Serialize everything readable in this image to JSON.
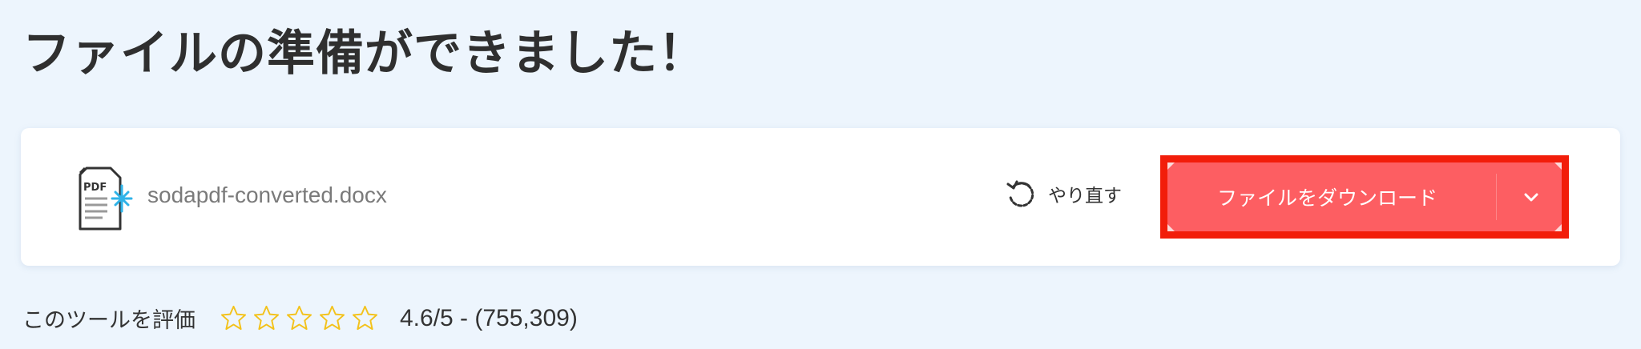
{
  "header": {
    "title": "ファイルの準備ができました！"
  },
  "file": {
    "icon": "pdf-file-icon",
    "icon_badge": "PDF",
    "name": "sodapdf-converted.docx"
  },
  "actions": {
    "redo_icon": "redo-icon",
    "redo_label": "やり直す",
    "download_label": "ファイルをダウンロード",
    "download_caret_icon": "chevron-down-icon"
  },
  "rating": {
    "label": "このツールを評価",
    "stars_total": 5,
    "stars_filled": 0,
    "score_text": "4.6/5 - (755,309)"
  },
  "colors": {
    "background": "#edf5fd",
    "card": "#ffffff",
    "download_button": "#fd5e62",
    "highlight_border": "#f21d0a",
    "star_outline": "#f3c21b",
    "icon_accent": "#2fb3e8"
  }
}
